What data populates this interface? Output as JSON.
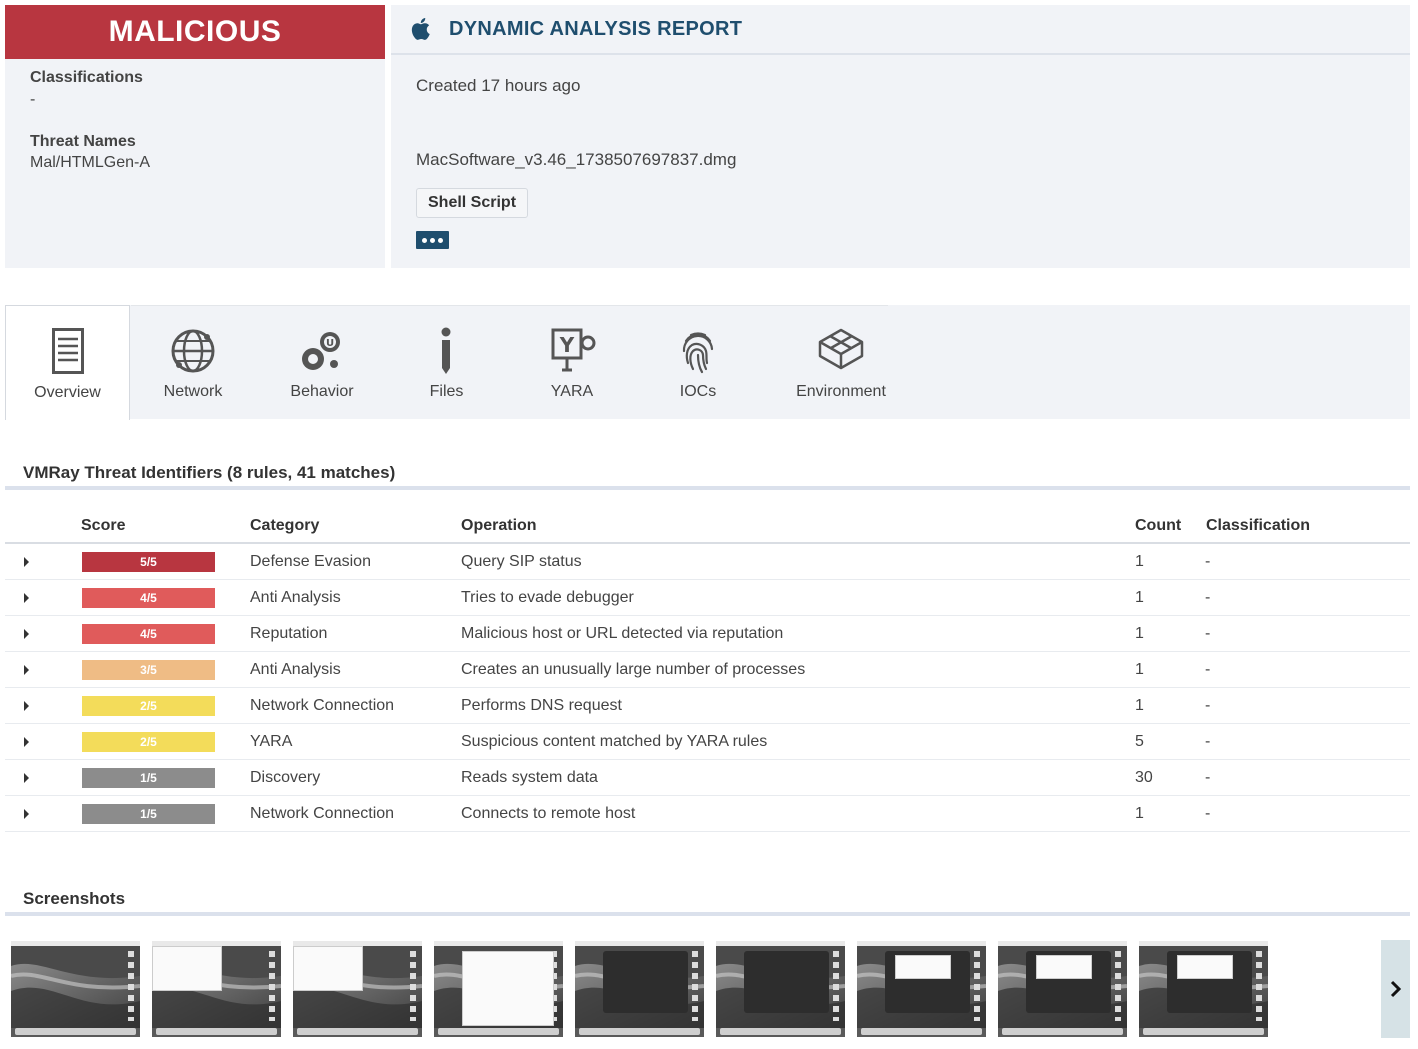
{
  "verdict": {
    "label": "MALICIOUS",
    "color": "#b83640"
  },
  "summary": {
    "classifications_label": "Classifications",
    "classifications_value": "-",
    "threat_names_label": "Threat Names",
    "threat_names_value": "Mal/HTMLGen-A"
  },
  "report": {
    "title": "DYNAMIC ANALYSIS REPORT",
    "platform_icon": "apple-icon",
    "created": "Created 17 hours ago",
    "filename": "MacSoftware_v3.46_1738507697837.dmg",
    "tag": "Shell Script",
    "more_icon": "ellipsis-icon"
  },
  "tabs": [
    {
      "label": "Overview",
      "icon": "document-icon",
      "active": true
    },
    {
      "label": "Network",
      "icon": "globe-icon",
      "active": false
    },
    {
      "label": "Behavior",
      "icon": "gears-icon",
      "active": false
    },
    {
      "label": "Files",
      "icon": "info-icon",
      "active": false
    },
    {
      "label": "YARA",
      "icon": "yara-icon",
      "active": false
    },
    {
      "label": "IOCs",
      "icon": "fingerprint-icon",
      "active": false
    },
    {
      "label": "Environment",
      "icon": "cube-icon",
      "active": false
    }
  ],
  "threat_identifiers": {
    "title": "VMRay Threat Identifiers (8 rules, 41 matches)",
    "columns": {
      "score": "Score",
      "category": "Category",
      "operation": "Operation",
      "count": "Count",
      "classification": "Classification"
    },
    "rows": [
      {
        "score": "5/5",
        "score_color": "#b83640",
        "category": "Defense Evasion",
        "operation": "Query SIP status",
        "count": "1",
        "classification": "-"
      },
      {
        "score": "4/5",
        "score_color": "#e05b5b",
        "category": "Anti Analysis",
        "operation": "Tries to evade debugger",
        "count": "1",
        "classification": "-"
      },
      {
        "score": "4/5",
        "score_color": "#e05b5b",
        "category": "Reputation",
        "operation": "Malicious host or URL detected via reputation",
        "count": "1",
        "classification": "-"
      },
      {
        "score": "3/5",
        "score_color": "#efbc85",
        "category": "Anti Analysis",
        "operation": "Creates an unusually large number of processes",
        "count": "1",
        "classification": "-"
      },
      {
        "score": "2/5",
        "score_color": "#f3dc5a",
        "category": "Network Connection",
        "operation": "Performs DNS request",
        "count": "1",
        "classification": "-"
      },
      {
        "score": "2/5",
        "score_color": "#f3dc5a",
        "category": "YARA",
        "operation": "Suspicious content matched by YARA rules",
        "count": "5",
        "classification": "-"
      },
      {
        "score": "1/5",
        "score_color": "#8c8c8c",
        "category": "Discovery",
        "operation": "Reads system data",
        "count": "30",
        "classification": "-"
      },
      {
        "score": "1/5",
        "score_color": "#8c8c8c",
        "category": "Network Connection",
        "operation": "Connects to remote host",
        "count": "1",
        "classification": "-"
      }
    ]
  },
  "screenshots": {
    "title": "Screenshots",
    "thumbnails": [
      "desktop",
      "desktop-window",
      "desktop-window",
      "white-window",
      "dark-installer",
      "dark-installer",
      "dark-installer-dialog",
      "dark-installer-dialog",
      "dark-installer-dialog"
    ],
    "next_icon": "chevron-right-icon"
  }
}
